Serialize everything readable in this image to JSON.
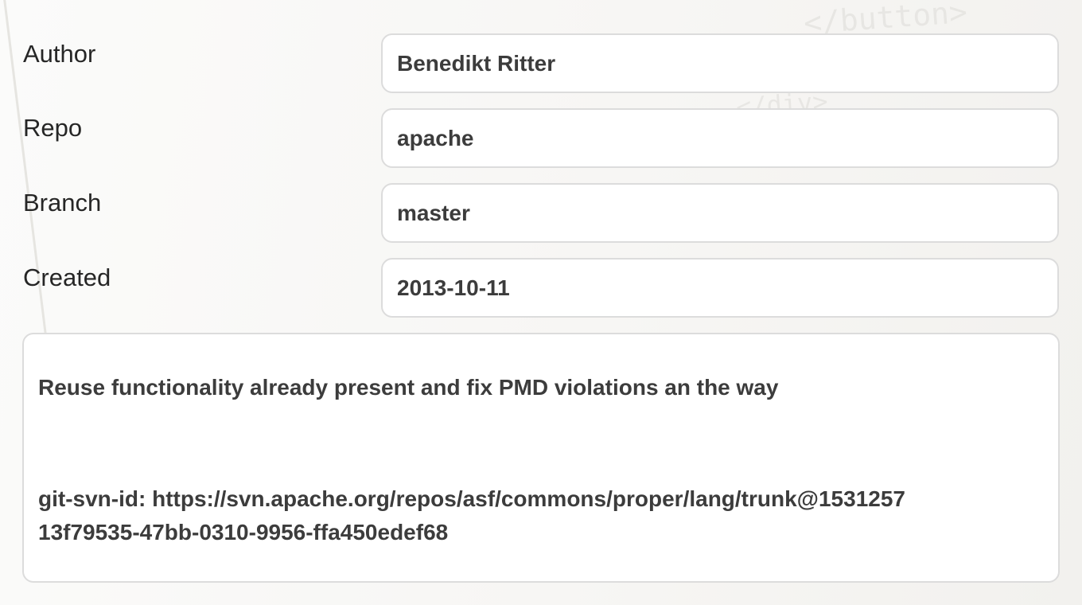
{
  "background": {
    "code_fragments": [
      "</button>",
      "</div>"
    ]
  },
  "details": {
    "author": {
      "label": "Author",
      "value": "Benedikt Ritter"
    },
    "repo": {
      "label": "Repo",
      "value": "apache"
    },
    "branch": {
      "label": "Branch",
      "value": "master"
    },
    "created": {
      "label": "Created",
      "value": "2013-10-11"
    }
  },
  "message": {
    "summary": "Reuse functionality already present and fix PMD violations an the way",
    "svn_id_line": "git-svn-id: https://svn.apache.org/repos/asf/commons/proper/lang/trunk@1531257",
    "uuid_line": "13f79535-47bb-0310-9956-ffa450edef68"
  },
  "colors": {
    "background": "#f6f5f3",
    "box_border": "#dcdcdc",
    "text": "#3c3c3c"
  }
}
